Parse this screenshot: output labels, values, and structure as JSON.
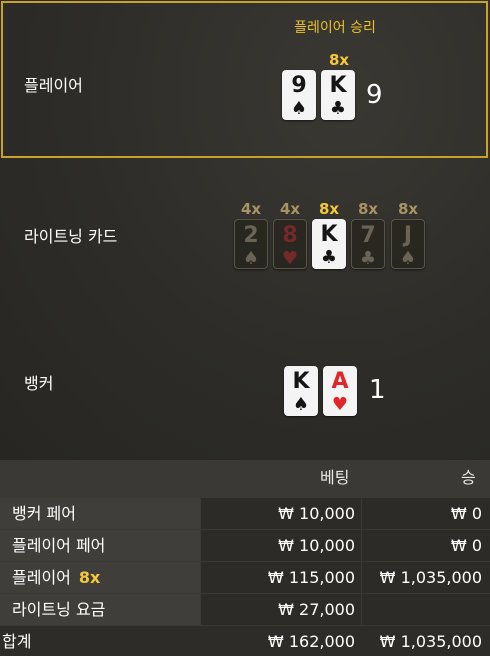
{
  "player": {
    "row_label": "플레이어",
    "winner_label": "플레이어 승리",
    "score": "9",
    "cards": [
      {
        "rank": "9",
        "suit": "♠",
        "color": "black"
      },
      {
        "rank": "K",
        "suit": "♣",
        "color": "black",
        "multiplier": "8x"
      }
    ]
  },
  "lightning": {
    "row_label": "라이트닝 카드",
    "cards": [
      {
        "rank": "2",
        "suit": "♠",
        "color": "black",
        "multiplier": "4x",
        "active": false
      },
      {
        "rank": "8",
        "suit": "♥",
        "color": "red",
        "multiplier": "4x",
        "active": false
      },
      {
        "rank": "K",
        "suit": "♣",
        "color": "black",
        "multiplier": "8x",
        "active": true
      },
      {
        "rank": "7",
        "suit": "♣",
        "color": "black",
        "multiplier": "8x",
        "active": false
      },
      {
        "rank": "J",
        "suit": "♠",
        "color": "black",
        "multiplier": "8x",
        "active": false
      }
    ]
  },
  "banker": {
    "row_label": "뱅커",
    "score": "1",
    "cards": [
      {
        "rank": "K",
        "suit": "♠",
        "color": "black"
      },
      {
        "rank": "A",
        "suit": "♥",
        "color": "red"
      }
    ]
  },
  "bets": {
    "header_bet": "베팅",
    "header_win": "승",
    "rows": [
      {
        "label": "뱅커 페어",
        "bet": "₩ 10,000",
        "win": "₩ 0"
      },
      {
        "label": "플레이어 페어",
        "bet": "₩ 10,000",
        "win": "₩ 0"
      },
      {
        "label": "플레이어",
        "multiplier": "8x",
        "bet": "₩ 115,000",
        "win": "₩ 1,035,000"
      },
      {
        "label": "라이트닝 요금",
        "bet": "₩ 27,000",
        "win": ""
      }
    ],
    "total": {
      "label": "합계",
      "bet": "₩ 162,000",
      "win": "₩ 1,035,000"
    }
  },
  "colors": {
    "gold": "#f5c739",
    "highlight_border": "#c9a227",
    "red_suit": "#e0262b"
  }
}
